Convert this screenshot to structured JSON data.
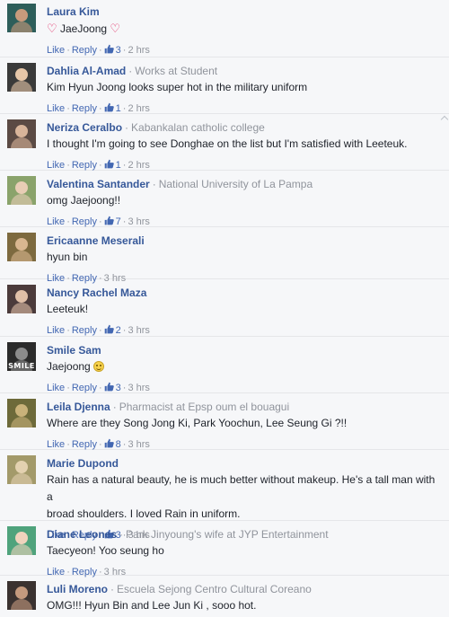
{
  "actions": {
    "like": "Like",
    "reply": "Reply"
  },
  "comments": [
    {
      "name": "Laura Kim",
      "affiliation": "",
      "pre_icon": "heart",
      "text": "JaeJoong",
      "post_icon": "heart",
      "text2": "",
      "likes": "3",
      "time": "2 hrs",
      "avatar_color": "#2d5e5a",
      "avatar_skin": "#c99b7c",
      "avatar_label": ""
    },
    {
      "name": "Dahlia Al-Amad",
      "affiliation": "Works at Student",
      "pre_icon": "",
      "text": "Kim Hyun Joong looks super hot in the military uniform",
      "post_icon": "",
      "text2": "",
      "likes": "1",
      "time": "2 hrs",
      "avatar_color": "#3a3a3a",
      "avatar_skin": "#e6c6a8",
      "avatar_label": ""
    },
    {
      "name": "Neriza Ceralbo",
      "affiliation": "Kabankalan catholic college",
      "pre_icon": "",
      "text": "I thought I'm going to see Donghae on the list but I'm satisfied with Leeteuk.",
      "post_icon": "",
      "text2": "",
      "likes": "1",
      "time": "2 hrs",
      "avatar_color": "#5b4a44",
      "avatar_skin": "#d8b49a",
      "avatar_label": ""
    },
    {
      "name": "Valentina Santander",
      "affiliation": "National University of La Pampa",
      "pre_icon": "",
      "text": "omg Jaejoong!!",
      "post_icon": "",
      "text2": "",
      "likes": "7",
      "time": "3 hrs",
      "avatar_color": "#8aa36b",
      "avatar_skin": "#e8cdb5",
      "avatar_label": ""
    },
    {
      "name": "Ericaanne Meserali",
      "affiliation": "",
      "pre_icon": "",
      "text": "hyun bin",
      "post_icon": "",
      "text2": "",
      "likes": "",
      "time": "3 hrs",
      "avatar_color": "#7d6a3f",
      "avatar_skin": "#d9b790",
      "avatar_label": ""
    },
    {
      "name": "Nancy Rachel Maza",
      "affiliation": "",
      "pre_icon": "",
      "text": "Leeteuk!",
      "post_icon": "",
      "text2": "",
      "likes": "2",
      "time": "3 hrs",
      "avatar_color": "#4b3b3b",
      "avatar_skin": "#e0c0a8",
      "avatar_label": ""
    },
    {
      "name": "Smile Sam",
      "affiliation": "",
      "pre_icon": "",
      "text": "Jaejoong",
      "post_icon": "smiley",
      "text2": "",
      "likes": "3",
      "time": "3 hrs",
      "avatar_color": "#2b2b2b",
      "avatar_skin": "#8c8c8c",
      "avatar_label": "SMILE"
    },
    {
      "name": "Leila Djenna",
      "affiliation": "Pharmacist at Epsp oum el bouagui",
      "pre_icon": "",
      "text": "Where are they Song Jong Ki, Park Yoochun, Lee Seung Gi ?!!",
      "post_icon": "",
      "text2": "",
      "likes": "8",
      "time": "3 hrs",
      "avatar_color": "#6d6a3a",
      "avatar_skin": "#c9b27a",
      "avatar_label": ""
    },
    {
      "name": "Marie Dupond",
      "affiliation": "",
      "pre_icon": "",
      "text": "Rain has a natural beauty, he is much better without makeup. He's a tall man with a",
      "post_icon": "",
      "text2": "broad shoulders. I loved Rain in uniform.",
      "likes": "3",
      "time": "3 hrs",
      "avatar_color": "#a39a6a",
      "avatar_skin": "#e3d1b0",
      "avatar_label": ""
    },
    {
      "name": "Diane Leones",
      "affiliation": "Park Jinyoung's wife at JYP Entertainment",
      "pre_icon": "",
      "text": "Taecyeon! Yoo seung ho",
      "post_icon": "",
      "text2": "",
      "likes": "",
      "time": "3 hrs",
      "avatar_color": "#4fa37c",
      "avatar_skin": "#efd3bd",
      "avatar_label": ""
    },
    {
      "name": "Luli Moreno",
      "affiliation": "Escuela Sejong Centro Cultural Coreano",
      "pre_icon": "",
      "text": "OMG!!! Hyun Bin and Lee Jun Ki , sooo hot.",
      "post_icon": "",
      "text2": "",
      "likes": "",
      "time": "",
      "avatar_color": "#3a3230",
      "avatar_skin": "#c49a7e",
      "avatar_label": ""
    }
  ]
}
